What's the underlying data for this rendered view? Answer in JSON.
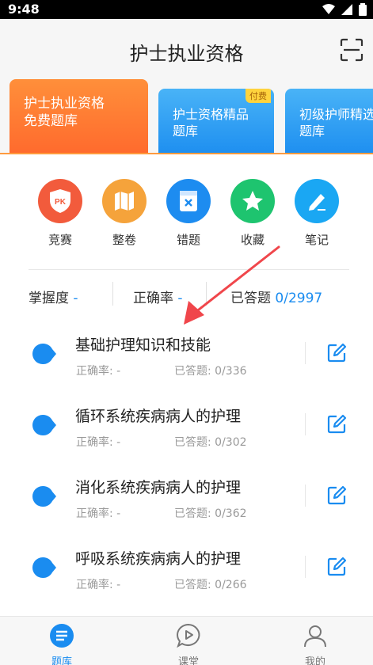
{
  "status": {
    "time": "9:48"
  },
  "header": {
    "title": "护士执业资格"
  },
  "banners": [
    {
      "text": "护士执业资格\n免费题库"
    },
    {
      "text": "护士资格精品\n题库",
      "badge": "付费"
    },
    {
      "text": "初级护师精选\n题库"
    }
  ],
  "quick_actions": [
    {
      "label": "竞赛",
      "icon": "pk-shield-icon",
      "color": "#f25b3c"
    },
    {
      "label": "整卷",
      "icon": "map-icon",
      "color": "#f5a33b"
    },
    {
      "label": "错题",
      "icon": "wrong-doc-icon",
      "color": "#1d8cf0"
    },
    {
      "label": "收藏",
      "icon": "star-icon",
      "color": "#1ec46f"
    },
    {
      "label": "笔记",
      "icon": "pen-icon",
      "color": "#1aa7f3"
    }
  ],
  "stats": {
    "mastery_label": "掌握度",
    "mastery_value": "-",
    "accuracy_label": "正确率",
    "accuracy_value": "-",
    "answered_label": "已答题",
    "answered_value": "0/2997"
  },
  "chapters": [
    {
      "title": "基础护理知识和技能",
      "accuracy": "正确率: -",
      "answered": "已答题: 0/336"
    },
    {
      "title": "循环系统疾病病人的护理",
      "accuracy": "正确率: -",
      "answered": "已答题: 0/302"
    },
    {
      "title": "消化系统疾病病人的护理",
      "accuracy": "正确率: -",
      "answered": "已答题: 0/362"
    },
    {
      "title": "呼吸系统疾病病人的护理",
      "accuracy": "正确率: -",
      "answered": "已答题: 0/266"
    }
  ],
  "nav": [
    {
      "label": "题库",
      "active": true
    },
    {
      "label": "课堂",
      "active": false
    },
    {
      "label": "我的",
      "active": false
    }
  ],
  "colors": {
    "accent": "#1a8cf0",
    "orange": "#ff7a33",
    "arrow": "#f0464b"
  }
}
